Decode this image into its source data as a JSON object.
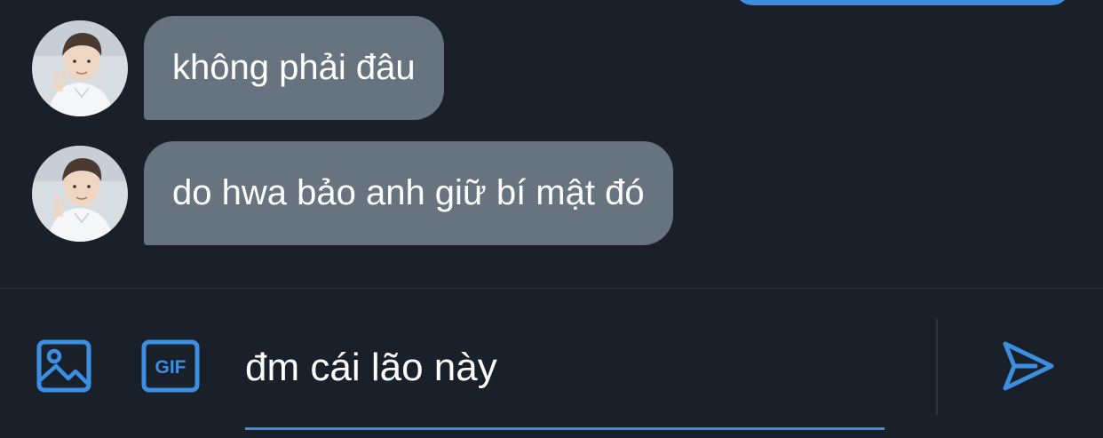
{
  "colors": {
    "background": "#1a202a",
    "received_bubble": "#67747f",
    "accent": "#3b8ee0",
    "text": "#ffffff"
  },
  "messages": [
    {
      "text": "không phải đâu",
      "direction": "received"
    },
    {
      "text": "do hwa bảo anh giữ bí mật đó",
      "direction": "received"
    }
  ],
  "composer": {
    "media_icon": "image-icon",
    "gif_icon": "gif-icon",
    "gif_label": "GIF",
    "input_value": "đm cái lão này",
    "send_icon": "send-icon"
  }
}
